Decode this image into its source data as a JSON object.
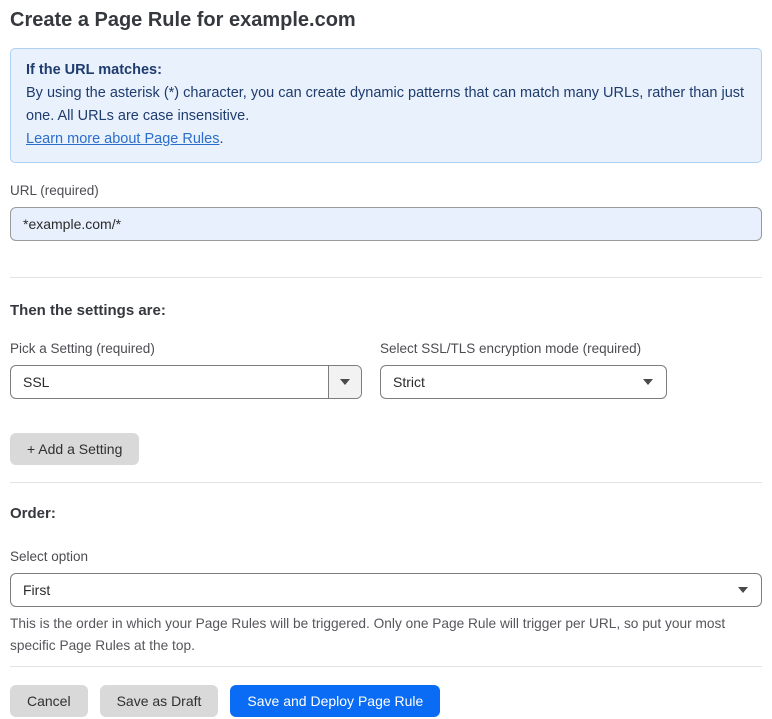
{
  "page": {
    "title": "Create a Page Rule for example.com"
  },
  "info_box": {
    "heading": "If the URL matches:",
    "body": "By using the asterisk (*) character, you can create dynamic patterns that can match many URLs, rather than just one. All URLs are case insensitive.",
    "link_label": "Learn more about Page Rules",
    "link_suffix": "."
  },
  "url_field": {
    "label": "URL (required)",
    "value": "*example.com/*"
  },
  "settings": {
    "heading": "Then the settings are:",
    "setting_picker": {
      "label": "Pick a Setting (required)",
      "value": "SSL"
    },
    "ssl_mode": {
      "label": "Select SSL/TLS encryption mode (required)",
      "value": "Strict"
    },
    "add_button_label": "+ Add a Setting"
  },
  "order": {
    "heading": "Order:",
    "label": "Select option",
    "value": "First",
    "help": "This is the order in which your Page Rules will be triggered. Only one Page Rule will trigger per URL, so put your most specific Page Rules at the top."
  },
  "footer": {
    "cancel_label": "Cancel",
    "save_draft_label": "Save as Draft",
    "save_deploy_label": "Save and Deploy Page Rule"
  },
  "colors": {
    "accent_blue": "#0a6cf4",
    "info_background": "#e9f1fc",
    "info_border": "#aed1f2",
    "info_text": "#1e3c6e",
    "link_blue": "#2c6ecb",
    "input_autofill_background": "#e8f0fe",
    "button_gray": "#d9d9d9"
  }
}
